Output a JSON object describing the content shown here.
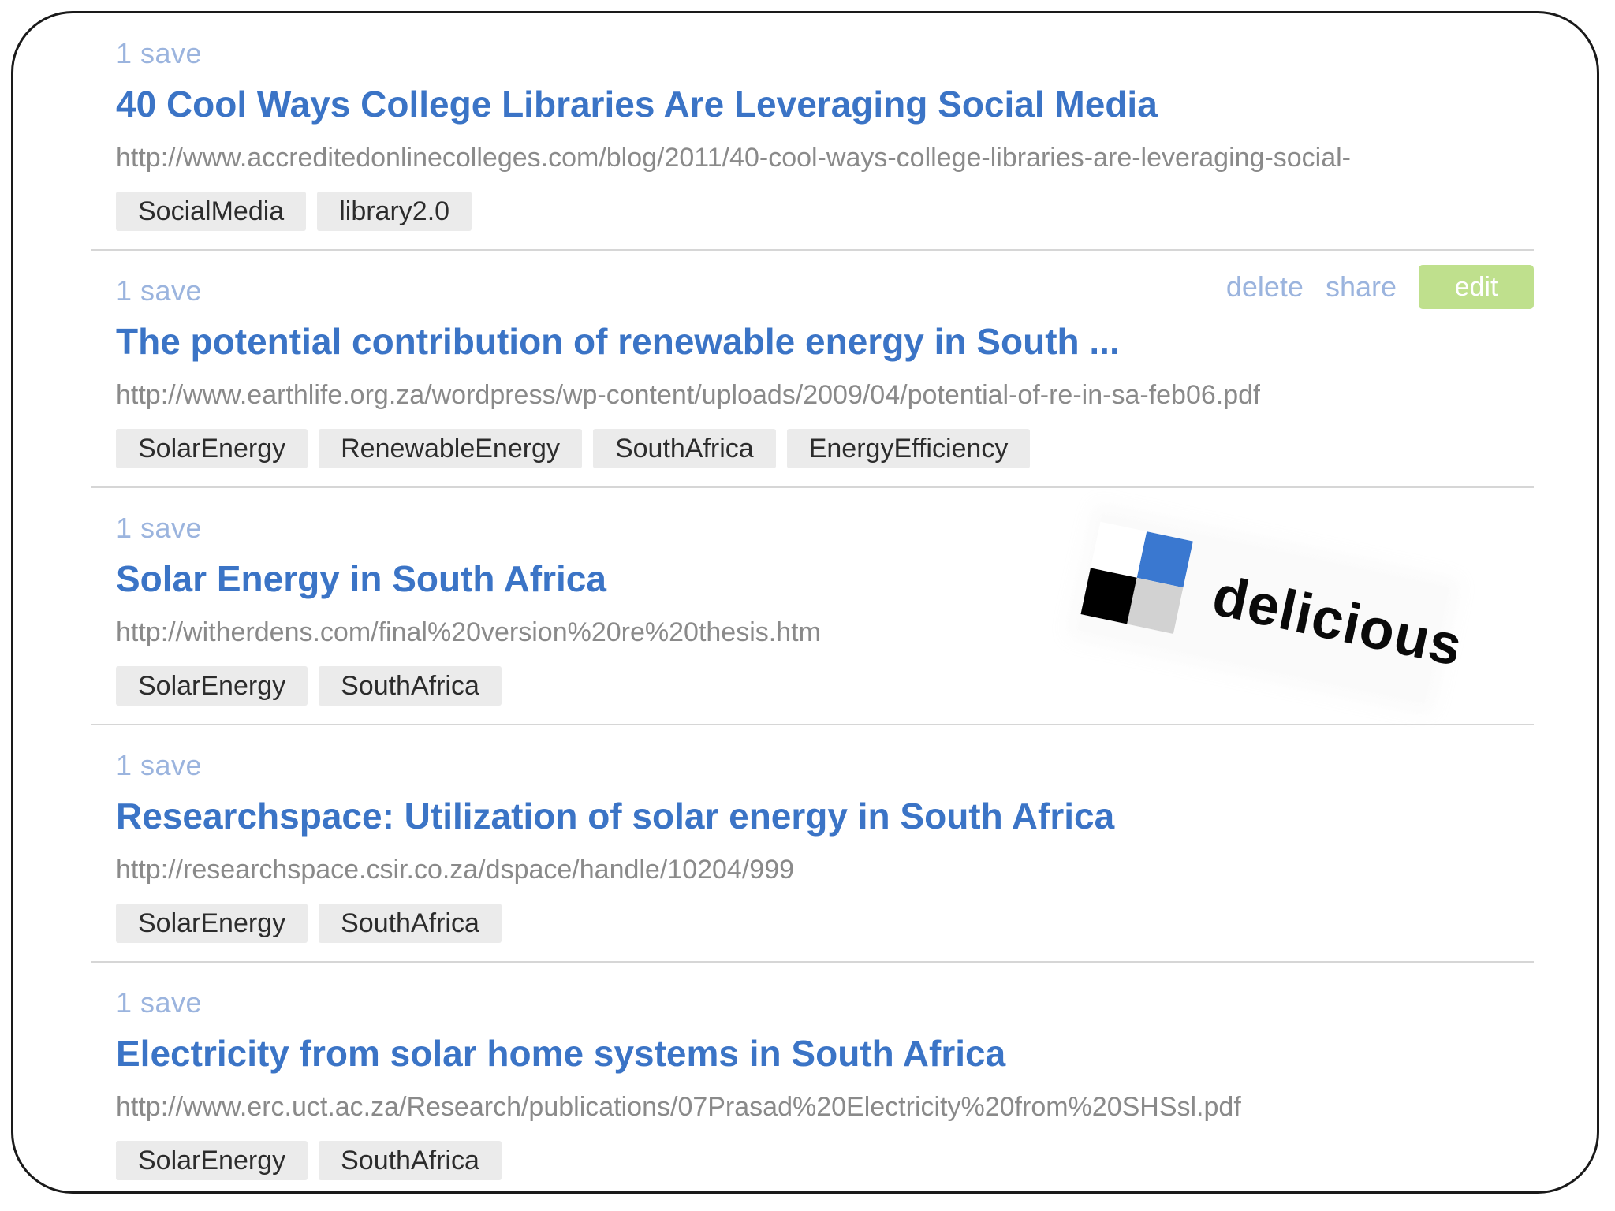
{
  "colors": {
    "link": "#3b74c6",
    "meta": "#9bb4de",
    "url": "#8a8a8a",
    "tag_bg": "#ebebeb",
    "edit_bg": "#bfe08d"
  },
  "bookmarks": [
    {
      "saves": "1 save",
      "title": "40 Cool Ways College Libraries Are Leveraging Social Media",
      "url": "http://www.accreditedonlinecolleges.com/blog/2011/40-cool-ways-college-libraries-are-leveraging-social-",
      "tags": [
        "SocialMedia",
        "library2.0"
      ]
    },
    {
      "saves": "1 save",
      "title": "The potential contribution of renewable energy in South ...",
      "url": "http://www.earthlife.org.za/wordpress/wp-content/uploads/2009/04/potential-of-re-in-sa-feb06.pdf",
      "tags": [
        "SolarEnergy",
        "RenewableEnergy",
        "SouthAfrica",
        "EnergyEfficiency"
      ],
      "actions": {
        "delete": "delete",
        "share": "share",
        "edit": "edit"
      }
    },
    {
      "saves": "1 save",
      "title": "Solar Energy in South Africa",
      "url": "http://witherdens.com/final%20version%20re%20thesis.htm",
      "tags": [
        "SolarEnergy",
        "SouthAfrica"
      ]
    },
    {
      "saves": "1 save",
      "title": "Researchspace: Utilization of solar energy in South Africa",
      "url": "http://researchspace.csir.co.za/dspace/handle/10204/999",
      "tags": [
        "SolarEnergy",
        "SouthAfrica"
      ]
    },
    {
      "saves": "1 save",
      "title": "Electricity from solar home systems in South Africa",
      "url": "http://www.erc.uct.ac.za/Research/publications/07Prasad%20Electricity%20from%20SHSsl.pdf",
      "tags": [
        "SolarEnergy",
        "SouthAfrica"
      ]
    }
  ],
  "logo": {
    "wordmark": "delicious",
    "icon": "delicious-logo-icon"
  }
}
